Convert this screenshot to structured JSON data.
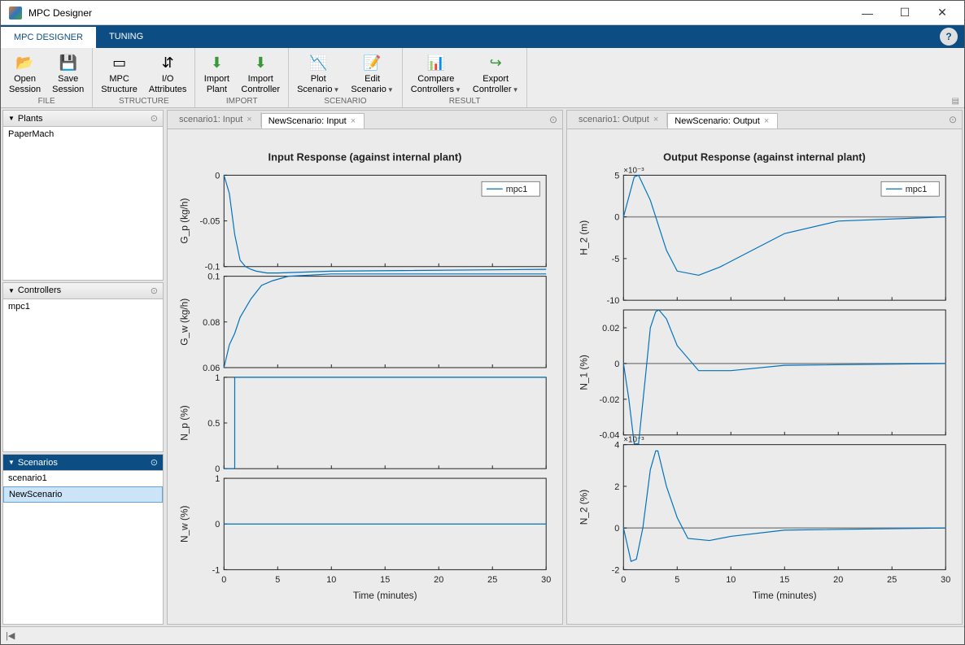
{
  "title": "MPC Designer",
  "menu": {
    "tab_designer": "MPC DESIGNER",
    "tab_tuning": "TUNING"
  },
  "toolstrip": {
    "file": {
      "section": "FILE",
      "open_session": "Open\nSession",
      "save_session": "Save\nSession"
    },
    "structure": {
      "section": "STRUCTURE",
      "mpc_structure": "MPC\nStructure",
      "io_attr": "I/O\nAttributes"
    },
    "import": {
      "section": "IMPORT",
      "import_plant": "Import\nPlant",
      "import_ctrl": "Import\nController"
    },
    "scenario": {
      "section": "SCENARIO",
      "plot_scenario": "Plot\nScenario",
      "edit_scenario": "Edit\nScenario"
    },
    "result": {
      "section": "RESULT",
      "compare_ctrl": "Compare\nControllers",
      "export_ctrl": "Export\nController"
    }
  },
  "panels": {
    "plants": {
      "title": "Plants",
      "items": [
        "PaperMach"
      ]
    },
    "controllers": {
      "title": "Controllers",
      "items": [
        "mpc1"
      ]
    },
    "scenarios": {
      "title": "Scenarios",
      "items": [
        "scenario1",
        "NewScenario"
      ],
      "selected": 1
    }
  },
  "input_tabs": {
    "t1": "scenario1: Input",
    "t2": "NewScenario: Input"
  },
  "output_tabs": {
    "t1": "scenario1: Output",
    "t2": "NewScenario: Output"
  },
  "legend": "mpc1",
  "chart_data": [
    {
      "type": "line",
      "group": "input",
      "title": "Input Response (against internal plant)",
      "xlabel": "Time (minutes)",
      "xlim": [
        0,
        30
      ],
      "subplots": [
        {
          "ylabel": "G_p  (kg/h)",
          "ylim": [
            -0.1,
            0
          ],
          "ticks": [
            0,
            -0.05,
            -0.1
          ],
          "series": [
            {
              "name": "mpc1",
              "x": [
                0,
                0.5,
                0.5,
                1,
                1,
                1.5,
                1.5,
                2,
                2,
                2.5,
                2.5,
                3,
                3,
                4,
                4,
                5,
                5,
                10,
                30
              ],
              "y": [
                0,
                -0.02,
                -0.02,
                -0.065,
                -0.065,
                -0.093,
                -0.093,
                -0.1,
                -0.1,
                -0.103,
                -0.103,
                -0.105,
                -0.105,
                -0.107,
                -0.107,
                -0.107,
                -0.107,
                -0.105,
                -0.103
              ]
            }
          ]
        },
        {
          "ylabel": "G_w  (kg/h)",
          "ylim": [
            0.06,
            0.1
          ],
          "ticks": [
            0.06,
            0.08,
            0.1
          ],
          "series": [
            {
              "name": "mpc1",
              "x": [
                0,
                0.5,
                0.5,
                1,
                1,
                1.5,
                1.5,
                2,
                2,
                2.5,
                2.5,
                3,
                3,
                3.5,
                3.5,
                4.5,
                4.5,
                6,
                6,
                10,
                10,
                30
              ],
              "y": [
                0.06,
                0.07,
                0.07,
                0.075,
                0.075,
                0.082,
                0.082,
                0.086,
                0.086,
                0.09,
                0.09,
                0.093,
                0.093,
                0.096,
                0.096,
                0.098,
                0.098,
                0.1,
                0.1,
                0.101,
                0.101,
                0.101
              ]
            }
          ]
        },
        {
          "ylabel": "N_p  (%)",
          "ylim": [
            0,
            1
          ],
          "ticks": [
            0,
            0.5,
            1
          ],
          "series": [
            {
              "name": "mpc1",
              "x": [
                0,
                1,
                1,
                30
              ],
              "y": [
                0,
                0,
                1,
                1
              ]
            }
          ]
        },
        {
          "ylabel": "N_w  (%)",
          "ylim": [
            -1,
            1
          ],
          "ticks": [
            -1,
            0,
            1
          ],
          "series": [
            {
              "name": "mpc1",
              "x": [
                0,
                30
              ],
              "y": [
                0,
                0
              ]
            }
          ]
        }
      ]
    },
    {
      "type": "line",
      "group": "output",
      "title": "Output Response (against internal plant)",
      "xlabel": "Time (minutes)",
      "xlim": [
        0,
        30
      ],
      "subplots": [
        {
          "ylabel": "H_2  (m)",
          "ylim": [
            -10,
            5
          ],
          "ticks": [
            -10,
            -5,
            0,
            5
          ],
          "exp": "×10^{-3}",
          "ref": 0,
          "series": [
            {
              "name": "mpc1",
              "x": [
                0,
                1,
                1.4,
                2.5,
                4,
                5,
                7,
                9,
                12,
                15,
                20,
                30
              ],
              "y": [
                0,
                4.8,
                5,
                2,
                -4,
                -6.5,
                -7,
                -6,
                -4,
                -2,
                -0.5,
                0
              ]
            }
          ]
        },
        {
          "ylabel": "N_1  (%)",
          "ylim": [
            -0.04,
            0.03
          ],
          "ticks": [
            -0.04,
            -0.02,
            0,
            0.02
          ],
          "ref": 0,
          "series": [
            {
              "name": "mpc1",
              "x": [
                0,
                0.5,
                1,
                1.4,
                2,
                2.5,
                3,
                3.3,
                4,
                5,
                7,
                10,
                15,
                30
              ],
              "y": [
                0,
                -0.02,
                -0.045,
                -0.045,
                -0.01,
                0.02,
                0.029,
                0.03,
                0.025,
                0.01,
                -0.004,
                -0.004,
                -0.001,
                0
              ]
            }
          ]
        },
        {
          "ylabel": "N_2  (%)",
          "ylim": [
            -2,
            4
          ],
          "ticks": [
            -2,
            0,
            2,
            4
          ],
          "exp": "×10^{-3}",
          "ref": 0,
          "series": [
            {
              "name": "mpc1",
              "x": [
                0,
                0.7,
                1.2,
                1.8,
                2.5,
                3,
                3.2,
                4,
                5,
                6,
                8,
                10,
                15,
                30
              ],
              "y": [
                0,
                -1.6,
                -1.5,
                0,
                2.8,
                3.7,
                3.7,
                2,
                0.5,
                -0.5,
                -0.6,
                -0.4,
                -0.1,
                0
              ]
            }
          ]
        }
      ]
    }
  ]
}
